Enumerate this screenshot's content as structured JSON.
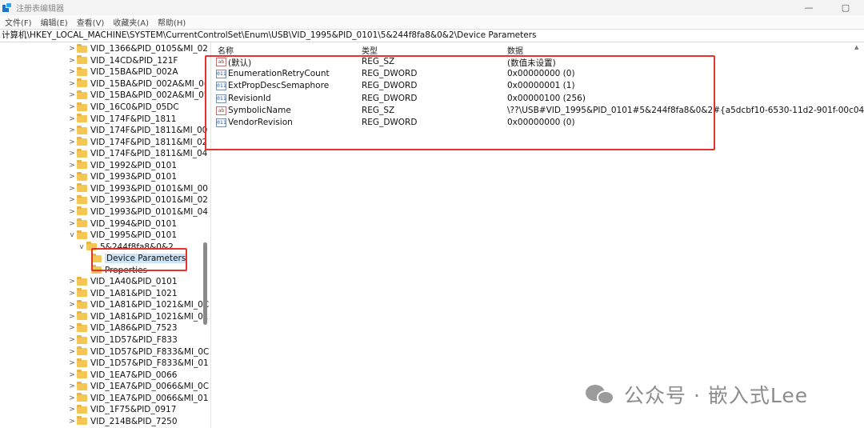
{
  "window": {
    "title": "注册表编辑器",
    "minimize_glyph": "—",
    "restore_glyph": "▢"
  },
  "menu": [
    "文件(F)",
    "编辑(E)",
    "查看(V)",
    "收藏夹(A)",
    "帮助(H)"
  ],
  "address": "计算机\\HKEY_LOCAL_MACHINE\\SYSTEM\\CurrentControlSet\\Enum\\USB\\VID_1995&PID_0101\\5&244f8fa8&0&2\\Device Parameters",
  "tree": {
    "items": [
      {
        "label": "VID_1366&PID_0105&MI_02",
        "expander": ">",
        "level": 0
      },
      {
        "label": "VID_14CD&PID_121F",
        "expander": ">",
        "level": 0
      },
      {
        "label": "VID_15BA&PID_002A",
        "expander": ">",
        "level": 0
      },
      {
        "label": "VID_15BA&PID_002A&MI_0(",
        "expander": ">",
        "level": 0
      },
      {
        "label": "VID_15BA&PID_002A&MI_0'",
        "expander": ">",
        "level": 0
      },
      {
        "label": "VID_16C0&PID_05DC",
        "expander": ">",
        "level": 0
      },
      {
        "label": "VID_174F&PID_1811",
        "expander": ">",
        "level": 0
      },
      {
        "label": "VID_174F&PID_1811&MI_00",
        "expander": ">",
        "level": 0
      },
      {
        "label": "VID_174F&PID_1811&MI_02",
        "expander": ">",
        "level": 0
      },
      {
        "label": "VID_174F&PID_1811&MI_04",
        "expander": ">",
        "level": 0
      },
      {
        "label": "VID_1992&PID_0101",
        "expander": ">",
        "level": 0
      },
      {
        "label": "VID_1993&PID_0101",
        "expander": ">",
        "level": 0
      },
      {
        "label": "VID_1993&PID_0101&MI_00",
        "expander": ">",
        "level": 0
      },
      {
        "label": "VID_1993&PID_0101&MI_02",
        "expander": ">",
        "level": 0
      },
      {
        "label": "VID_1993&PID_0101&MI_04",
        "expander": ">",
        "level": 0
      },
      {
        "label": "VID_1994&PID_0101",
        "expander": ">",
        "level": 0
      },
      {
        "label": "VID_1995&PID_0101",
        "expander": "v",
        "level": 0
      },
      {
        "label": "5&244f8fa8&0&2",
        "expander": "v",
        "level": 1
      },
      {
        "label": "Device Parameters",
        "expander": "",
        "level": 2,
        "selected": true
      },
      {
        "label": "Properties",
        "expander": "",
        "level": 2
      },
      {
        "label": "VID_1A40&PID_0101",
        "expander": ">",
        "level": 0
      },
      {
        "label": "VID_1A81&PID_1021",
        "expander": ">",
        "level": 0
      },
      {
        "label": "VID_1A81&PID_1021&MI_0C",
        "expander": ">",
        "level": 0
      },
      {
        "label": "VID_1A81&PID_1021&MI_01",
        "expander": ">",
        "level": 0
      },
      {
        "label": "VID_1A86&PID_7523",
        "expander": ">",
        "level": 0
      },
      {
        "label": "VID_1D57&PID_F833",
        "expander": ">",
        "level": 0
      },
      {
        "label": "VID_1D57&PID_F833&MI_0C",
        "expander": ">",
        "level": 0
      },
      {
        "label": "VID_1D57&PID_F833&MI_01",
        "expander": ">",
        "level": 0
      },
      {
        "label": "VID_1EA7&PID_0066",
        "expander": ">",
        "level": 0
      },
      {
        "label": "VID_1EA7&PID_0066&MI_0C",
        "expander": ">",
        "level": 0
      },
      {
        "label": "VID_1EA7&PID_0066&MI_01",
        "expander": ">",
        "level": 0
      },
      {
        "label": "VID_1F75&PID_0917",
        "expander": ">",
        "level": 0
      },
      {
        "label": "VID_214B&PID_7250",
        "expander": ">",
        "level": 0
      }
    ]
  },
  "values": {
    "headers": {
      "name": "名称",
      "type": "类型",
      "data": "数据"
    },
    "rows": [
      {
        "icon": "string-value-icon",
        "icon_text": "ab",
        "name": "(默认)",
        "type": "REG_SZ",
        "data": "(数值未设置)"
      },
      {
        "icon": "binary-value-icon",
        "icon_text": "011",
        "name": "EnumerationRetryCount",
        "type": "REG_DWORD",
        "data": "0x00000000 (0)"
      },
      {
        "icon": "binary-value-icon",
        "icon_text": "011",
        "name": "ExtPropDescSemaphore",
        "type": "REG_DWORD",
        "data": "0x00000001 (1)"
      },
      {
        "icon": "binary-value-icon",
        "icon_text": "011",
        "name": "RevisionId",
        "type": "REG_DWORD",
        "data": "0x00000100 (256)"
      },
      {
        "icon": "string-value-icon",
        "icon_text": "ab",
        "name": "SymbolicName",
        "type": "REG_SZ",
        "data": "\\??\\USB#VID_1995&PID_0101#5&244f8fa8&0&2#{a5dcbf10-6530-11d2-901f-00c04f..."
      },
      {
        "icon": "binary-value-icon",
        "icon_text": "011",
        "name": "VendorRevision",
        "type": "REG_DWORD",
        "data": "0x00000000 (0)"
      }
    ]
  },
  "colors": {
    "annotation": "#e5322d",
    "selection": "#cce4f7",
    "folder": "#f4c653"
  },
  "watermark": "公众号 · 嵌入式Lee"
}
